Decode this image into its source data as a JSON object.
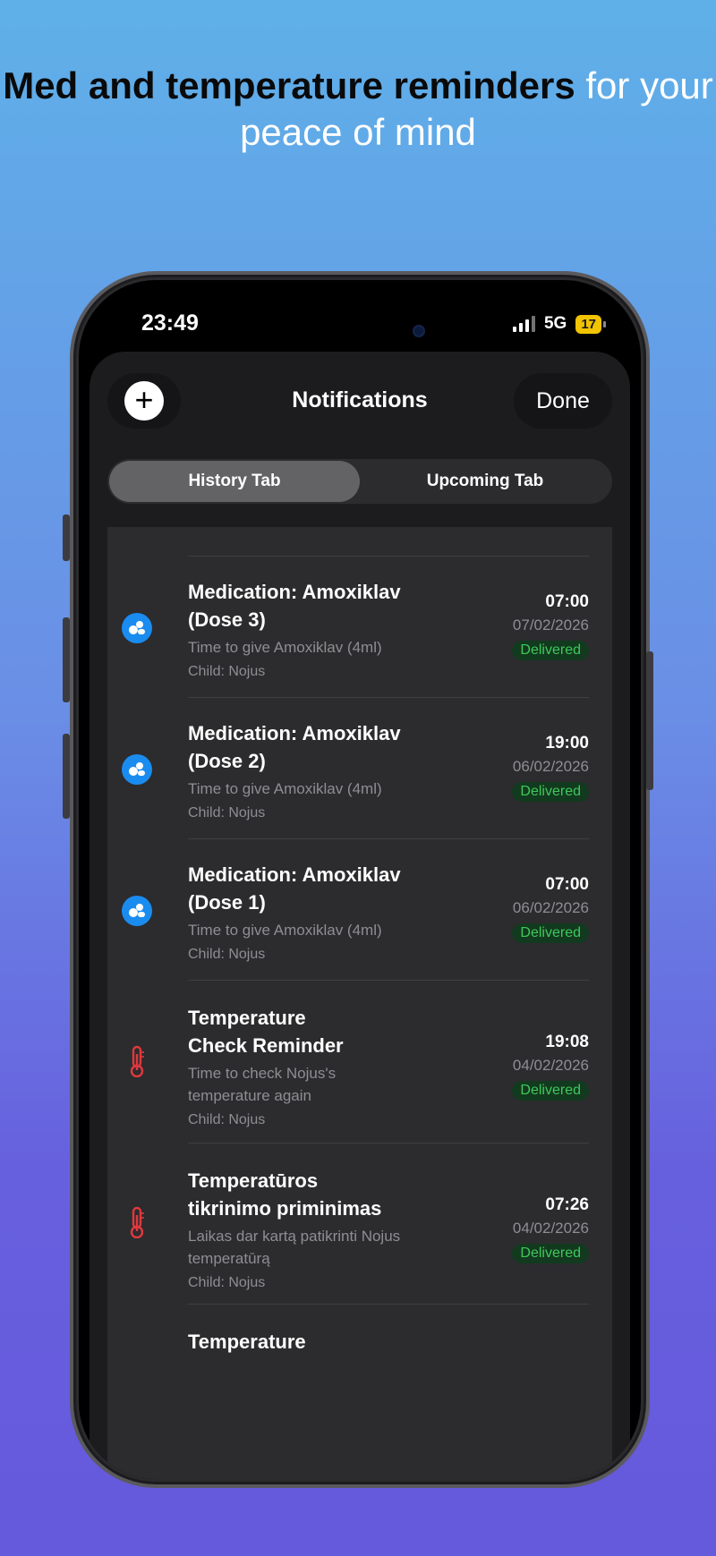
{
  "headline": {
    "bold": "Med and temperature reminders",
    "light": "for your peace of mind"
  },
  "status_bar": {
    "time": "23:49",
    "network": "5G",
    "battery": "17"
  },
  "header": {
    "add_icon": "plus-icon",
    "title": "Notifications",
    "done_label": "Done"
  },
  "tabs": [
    {
      "label": "History Tab",
      "active": true
    },
    {
      "label": "Upcoming Tab",
      "active": false
    }
  ],
  "notifications": [
    {
      "type": "medication",
      "icon": "pill-icon",
      "title_line1": "Medication: Amoxiklav",
      "title_line2": "(Dose 3)",
      "message": "Time to give Amoxiklav (4ml)",
      "child": "Child: Nojus",
      "time": "07:00",
      "date": "07/02/2026",
      "status": "Delivered"
    },
    {
      "type": "medication",
      "icon": "pill-icon",
      "title_line1": "Medication: Amoxiklav",
      "title_line2": "(Dose 2)",
      "message": "Time to give Amoxiklav (4ml)",
      "child": "Child: Nojus",
      "time": "19:00",
      "date": "06/02/2026",
      "status": "Delivered"
    },
    {
      "type": "medication",
      "icon": "pill-icon",
      "title_line1": "Medication: Amoxiklav",
      "title_line2": "(Dose 1)",
      "message": "Time to give Amoxiklav (4ml)",
      "child": "Child: Nojus",
      "time": "07:00",
      "date": "06/02/2026",
      "status": "Delivered"
    },
    {
      "type": "temperature",
      "icon": "thermometer-icon",
      "title_line1": "Temperature",
      "title_line2": "Check Reminder",
      "message_line1": "Time to check Nojus's",
      "message_line2": "temperature again",
      "child": "Child: Nojus",
      "time": "19:08",
      "date": "04/02/2026",
      "status": "Delivered"
    },
    {
      "type": "temperature",
      "icon": "thermometer-icon",
      "title_line1": "Temperatūros",
      "title_line2": "tikrinimo priminimas",
      "message_line1": "Laikas dar kartą patikrinti Nojus",
      "message_line2": "temperatūrą",
      "child": "Child: Nojus",
      "time": "07:26",
      "date": "04/02/2026",
      "status": "Delivered"
    },
    {
      "type": "temperature",
      "icon": "thermometer-icon",
      "title_line1": "Temperature"
    }
  ],
  "colors": {
    "medication_icon": "#1a8cf0",
    "temperature_icon": "#e0383e",
    "delivered_text": "#3fc85c",
    "delivered_bg": "#123a1e"
  }
}
